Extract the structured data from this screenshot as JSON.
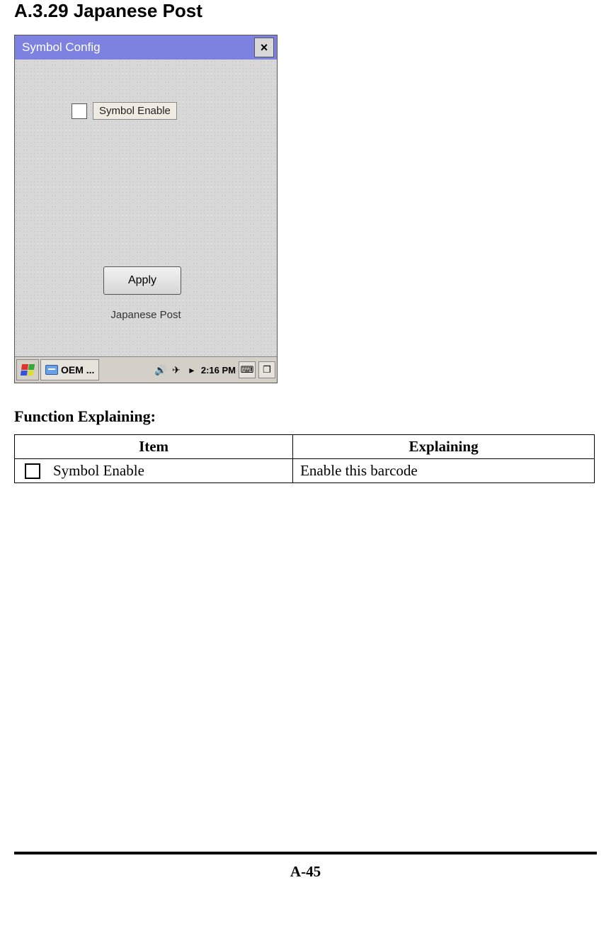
{
  "section_title": "A.3.29 Japanese Post",
  "screenshot": {
    "titlebar": "Symbol Config",
    "close_glyph": "×",
    "checkbox_label": "Symbol Enable",
    "apply_label": "Apply",
    "footer_label": "Japanese Post",
    "taskbar": {
      "task_label": "OEM ...",
      "time_prefix": "▸",
      "time": "2:16 PM"
    }
  },
  "function_heading": "Function Explaining:",
  "table": {
    "headers": {
      "item": "Item",
      "explaining": "Explaining"
    },
    "rows": [
      {
        "item": "Symbol Enable",
        "explaining": "Enable this barcode"
      }
    ]
  },
  "page_number": "A-45"
}
